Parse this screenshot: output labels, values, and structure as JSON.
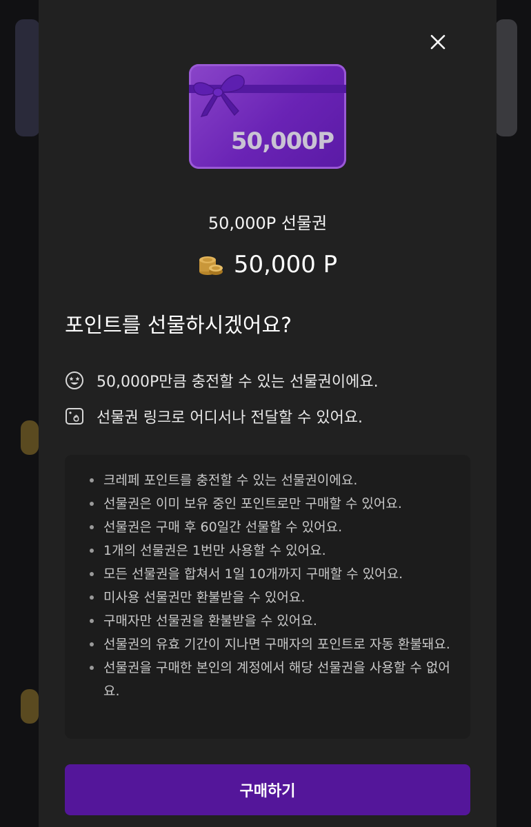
{
  "card": {
    "value_label": "50,000P"
  },
  "product": {
    "name": "50,000P 선물권",
    "price": "50,000 P"
  },
  "question": "포인트를 선물하시겠어요?",
  "features": [
    {
      "icon": "star-eyes-smiley-icon",
      "text": "50,000P만큼 충전할 수 있는 선물권이에요."
    },
    {
      "icon": "share-image-icon",
      "text": "선물권 링크로 어디서나 전달할 수 있어요."
    }
  ],
  "notices": [
    "크레페 포인트를 충전할 수 있는 선물권이에요.",
    "선물권은 이미 보유 중인 포인트로만 구매할 수 있어요.",
    "선물권은 구매 후 60일간 선물할 수 있어요.",
    "1개의 선물권은 1번만 사용할 수 있어요.",
    "모든 선물권을 합쳐서 1일 10개까지 구매할 수 있어요.",
    "미사용 선물권만 환불받을 수 있어요.",
    "구매자만 선물권을 환불받을 수 있어요.",
    "선물권의 유효 기간이 지나면 구매자의 포인트로 자동 환불돼요.",
    "선물권을 구매한 본인의 계정에서 해당 선물권을 사용할 수 없어요."
  ],
  "buttons": {
    "buy_label": "구매하기"
  },
  "colors": {
    "accent": "#54169a",
    "card": "#7a34c2",
    "modal_bg": "#212121"
  }
}
